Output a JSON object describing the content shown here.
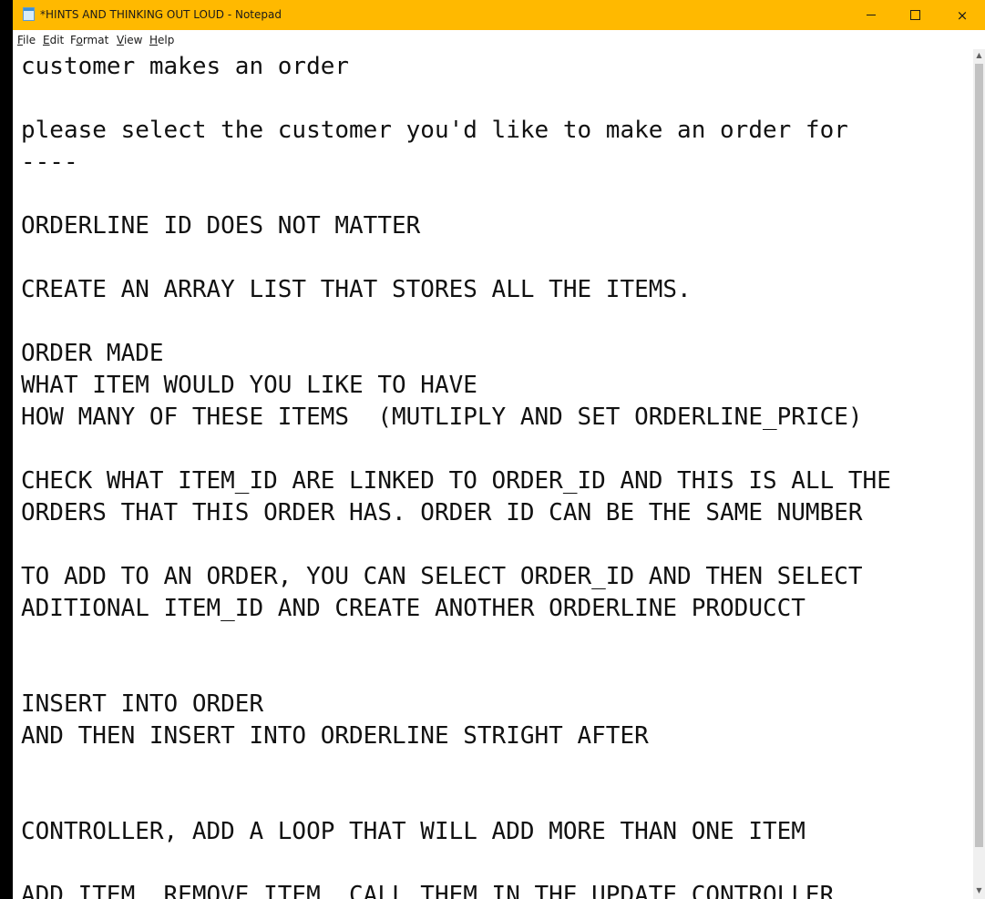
{
  "window": {
    "title": "*HINTS AND THINKING OUT LOUD - Notepad",
    "accent_color": "#ffb900",
    "app_icon": "notepad-icon",
    "controls": {
      "minimize": "minimize-icon",
      "maximize": "maximize-icon",
      "close": "×"
    }
  },
  "menu": {
    "file": {
      "key": "F",
      "rest": "ile"
    },
    "edit": {
      "key": "E",
      "rest": "dit"
    },
    "format": {
      "pre": "F",
      "key": "o",
      "rest": "rmat"
    },
    "view": {
      "key": "V",
      "rest": "iew"
    },
    "help": {
      "key": "H",
      "rest": "elp"
    }
  },
  "document": {
    "lines": [
      "customer makes an order",
      "",
      "please select the customer you'd like to make an order for",
      "----",
      "",
      "ORDERLINE ID DOES NOT MATTER",
      "",
      "CREATE AN ARRAY LIST THAT STORES ALL THE ITEMS.",
      "",
      "ORDER MADE",
      "WHAT ITEM WOULD YOU LIKE TO HAVE",
      "HOW MANY OF THESE ITEMS  (MUTLIPLY AND SET ORDERLINE_PRICE)",
      "",
      "CHECK WHAT ITEM_ID ARE LINKED TO ORDER_ID AND THIS IS ALL THE",
      "ORDERS THAT THIS ORDER HAS. ORDER ID CAN BE THE SAME NUMBER",
      "",
      "TO ADD TO AN ORDER, YOU CAN SELECT ORDER_ID AND THEN SELECT",
      "ADITIONAL ITEM_ID AND CREATE ANOTHER ORDERLINE PRODUCCT",
      "",
      "",
      "INSERT INTO ORDER",
      "AND THEN INSERT INTO ORDERLINE STRIGHT AFTER",
      "",
      "",
      "CONTROLLER, ADD A LOOP THAT WILL ADD MORE THAN ONE ITEM",
      "",
      "ADD ITEM, REMOVE ITEM, CALL THEM IN THE UPDATE CONTROLLER"
    ]
  },
  "scrollbar": {
    "up": "▲",
    "down": "▼"
  }
}
